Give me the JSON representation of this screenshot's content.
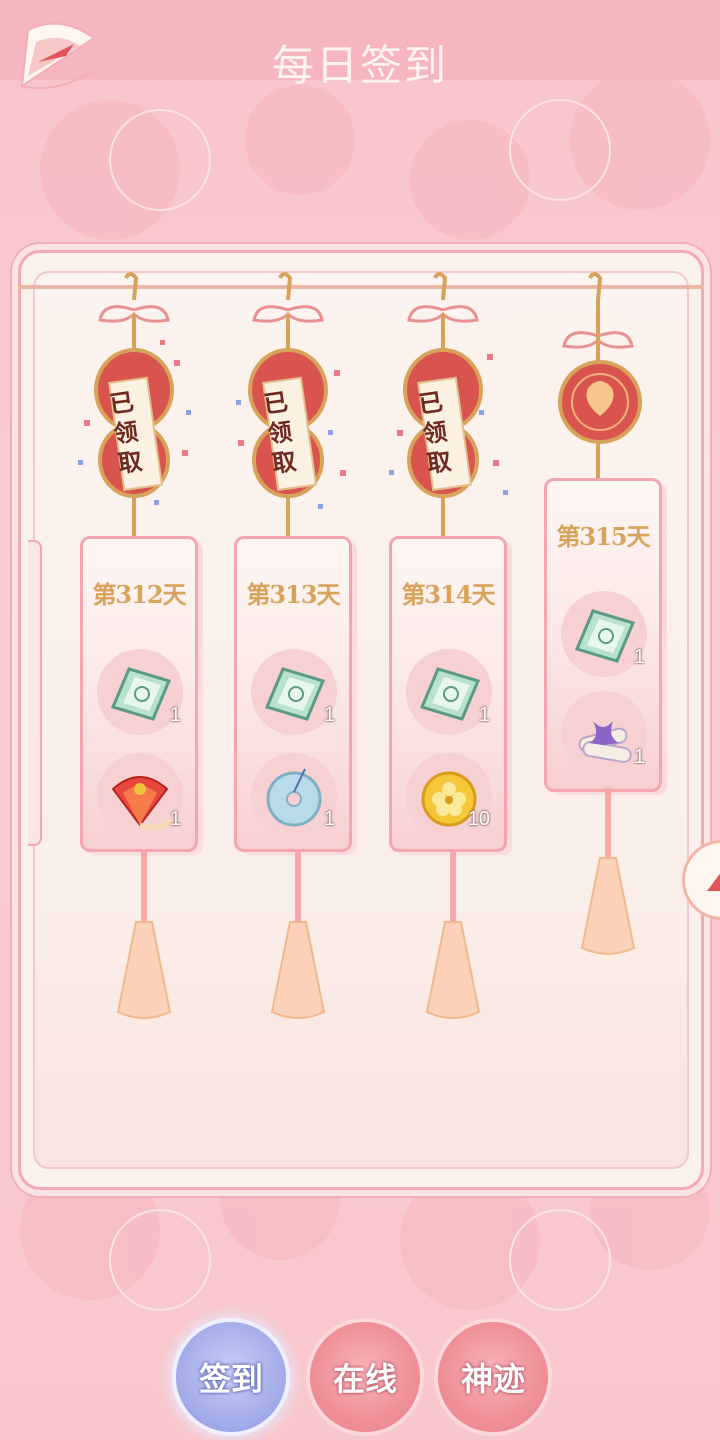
{
  "header": {
    "title": "每日签到"
  },
  "stamp_text": "已领取",
  "days": [
    {
      "label": "第312天",
      "claimed": true,
      "rewards": [
        {
          "icon": "money-note-icon",
          "qty": "1"
        },
        {
          "icon": "red-fan-icon",
          "qty": "1"
        }
      ]
    },
    {
      "label": "第313天",
      "claimed": true,
      "rewards": [
        {
          "icon": "money-note-icon",
          "qty": "1"
        },
        {
          "icon": "jade-disc-icon",
          "qty": "1"
        }
      ]
    },
    {
      "label": "第314天",
      "claimed": true,
      "rewards": [
        {
          "icon": "money-note-icon",
          "qty": "1"
        },
        {
          "icon": "gold-coin-icon",
          "qty": "10"
        }
      ]
    },
    {
      "label": "第315天",
      "claimed": false,
      "rewards": [
        {
          "icon": "money-note-icon",
          "qty": "1"
        },
        {
          "icon": "scroll-bundle-icon",
          "qty": "1"
        }
      ]
    }
  ],
  "tabs": [
    {
      "label": "签到",
      "active": true
    },
    {
      "label": "在线",
      "active": false
    },
    {
      "label": "神迹",
      "active": false
    }
  ],
  "colors": {
    "accent": "#f3a6ad",
    "day_text": "#d8a35a",
    "active_tab": "#a6aeea",
    "idle_tab": "#ef8f98"
  }
}
